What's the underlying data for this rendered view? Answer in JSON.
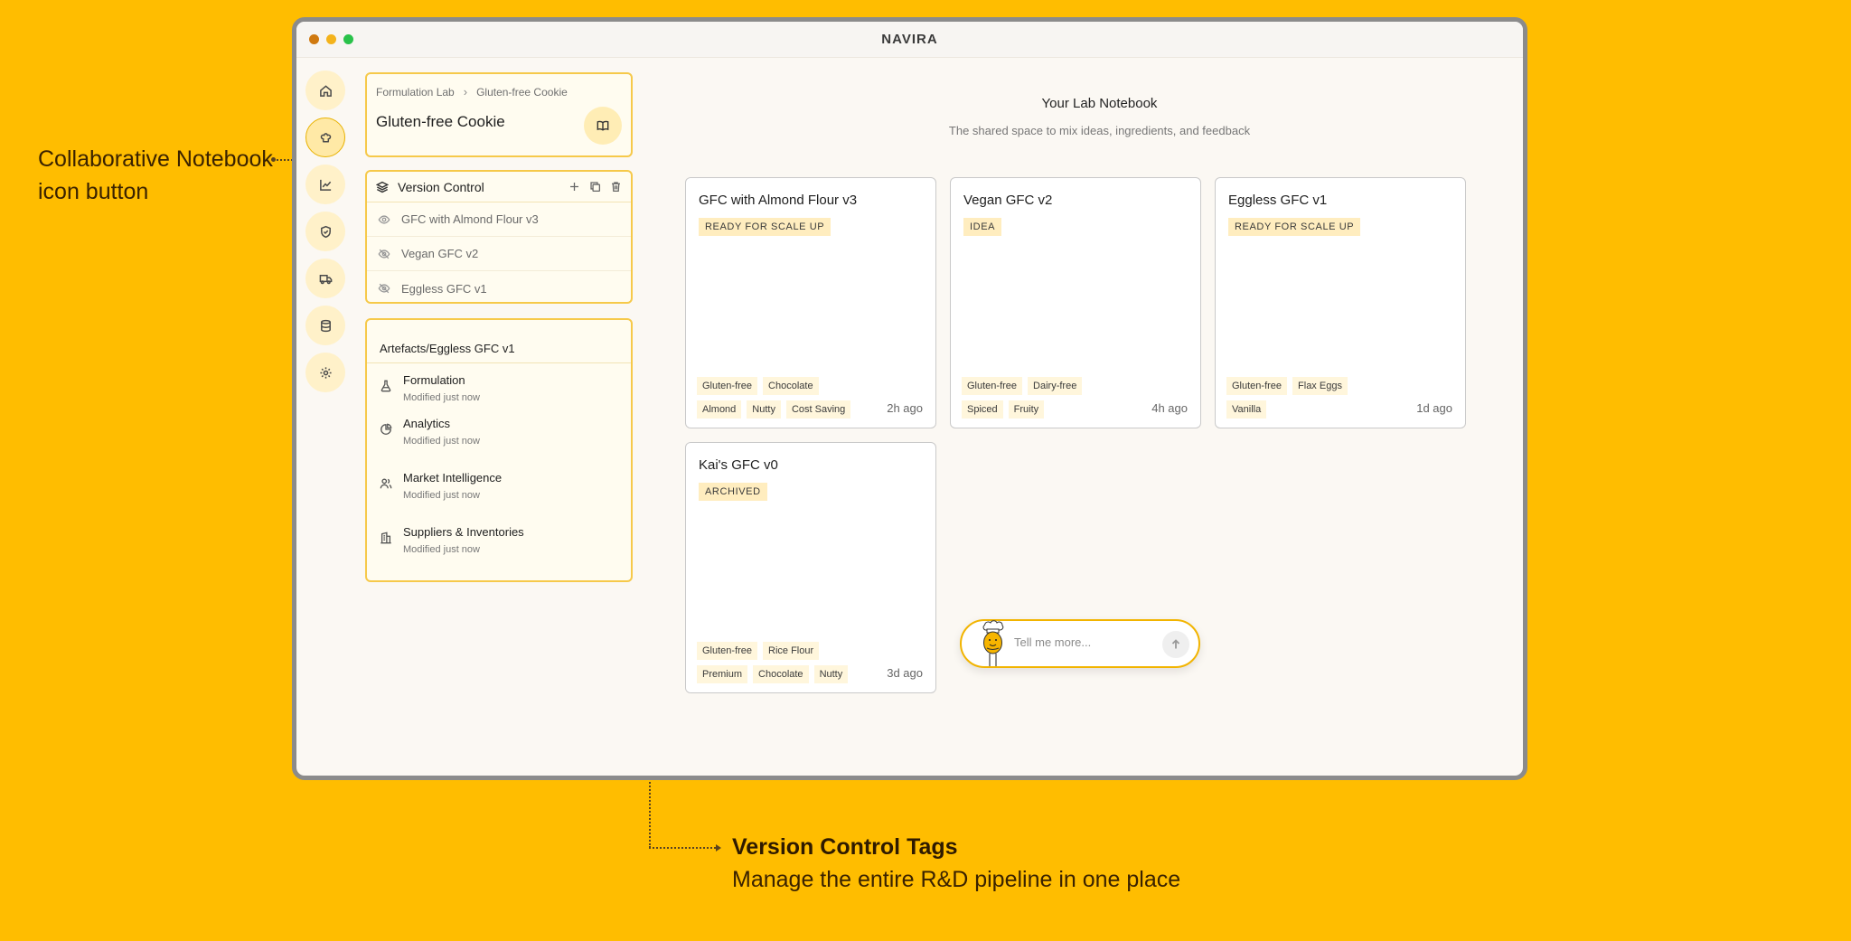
{
  "callouts": {
    "notebook": {
      "line1": "Collaborative Notebook",
      "line2": "icon button"
    },
    "tags": {
      "title": "Version Control Tags",
      "subtitle": "Manage the entire R&D pipeline in one place"
    }
  },
  "window": {
    "app_title": "NAVIRA"
  },
  "rail": {
    "items": [
      "home-icon",
      "chef-hat-icon",
      "chart-icon",
      "shield-icon",
      "truck-icon",
      "database-icon",
      "gear-icon"
    ],
    "active_index": 1
  },
  "breadcrumb": {
    "items": [
      "Formulation Lab",
      "Gluten-free Cookie"
    ],
    "title": "Gluten-free Cookie"
  },
  "version_control": {
    "title": "Version Control",
    "items": [
      {
        "label": "GFC with Almond Flour v3",
        "visible": true
      },
      {
        "label": "Vegan GFC v2",
        "visible": false
      },
      {
        "label": "Eggless GFC v1",
        "visible": false
      }
    ]
  },
  "artefacts": {
    "title": "Artefacts/Eggless GFC v1",
    "items": [
      {
        "name": "Formulation",
        "modified": "Modified just now",
        "icon": "flask-icon"
      },
      {
        "name": "Analytics",
        "modified": "Modified just now",
        "icon": "pie-icon"
      },
      {
        "name": "Market Intelligence",
        "modified": "Modified just now",
        "icon": "users-icon"
      },
      {
        "name": "Suppliers & Inventories",
        "modified": "Modified just now",
        "icon": "building-icon"
      }
    ]
  },
  "main": {
    "title": "Your Lab Notebook",
    "subtitle": "The shared space to mix ideas, ingredients, and feedback"
  },
  "cards": [
    {
      "name": "GFC with Almond Flour v3",
      "status": "READY FOR SCALE UP",
      "tags": [
        "Gluten-free",
        "Chocolate",
        "Almond",
        "Nutty",
        "Cost Saving"
      ],
      "time": "2h ago"
    },
    {
      "name": "Vegan GFC v2",
      "status": "IDEA",
      "tags": [
        "Gluten-free",
        "Dairy-free",
        "Spiced",
        "Fruity"
      ],
      "time": "4h ago"
    },
    {
      "name": "Eggless GFC v1",
      "status": "READY FOR SCALE UP",
      "tags": [
        "Gluten-free",
        "Flax Eggs",
        "Vanilla"
      ],
      "time": "1d ago"
    },
    {
      "name": "Kai's GFC v0",
      "status": "ARCHIVED",
      "tags": [
        "Gluten-free",
        "Rice Flour",
        "Premium",
        "Chocolate",
        "Nutty"
      ],
      "time": "3d ago"
    }
  ],
  "chat": {
    "placeholder": "Tell me more..."
  }
}
